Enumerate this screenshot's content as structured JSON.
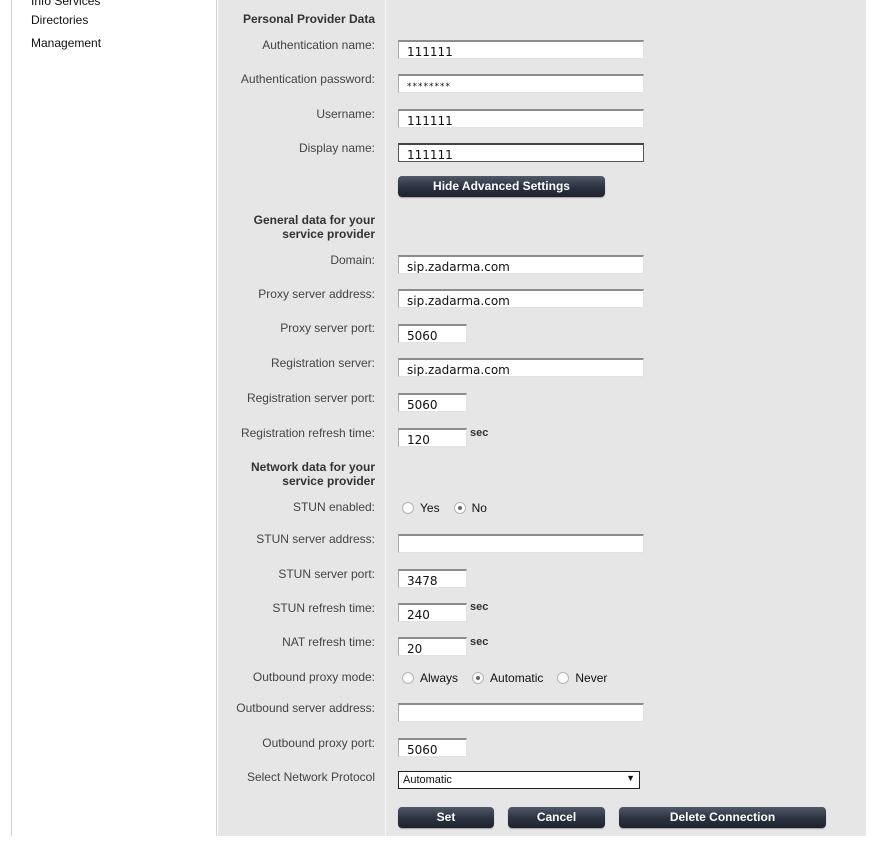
{
  "nav": {
    "items": [
      "Info Services",
      "Directories",
      "Management"
    ]
  },
  "personal": {
    "title": "Personal Provider Data",
    "auth_name_label": "Authentication name:",
    "auth_name_value": "111111",
    "auth_password_label": "Authentication password:",
    "auth_password_value": "********",
    "username_label": "Username:",
    "username_value": "111111",
    "display_name_label": "Display name:",
    "display_name_value": "111111"
  },
  "advanced_button": "Hide Advanced Settings",
  "general": {
    "title_line1": "General data for your",
    "title_line2": "service provider",
    "domain_label": "Domain:",
    "domain_value": "sip.zadarma.com",
    "proxy_address_label": "Proxy server address:",
    "proxy_address_value": "sip.zadarma.com",
    "proxy_port_label": "Proxy server port:",
    "proxy_port_value": "5060",
    "registration_server_label": "Registration server:",
    "registration_server_value": "sip.zadarma.com",
    "registration_port_label": "Registration server port:",
    "registration_port_value": "5060",
    "registration_refresh_label": "Registration refresh time:",
    "registration_refresh_value": "120",
    "unit_sec": "sec"
  },
  "network": {
    "title_line1": "Network data for your",
    "title_line2": "service provider",
    "stun_enabled_label": "STUN enabled:",
    "stun_options": [
      "Yes",
      "No"
    ],
    "stun_selected": "No",
    "stun_address_label": "STUN server address:",
    "stun_address_value": "",
    "stun_port_label": "STUN server port:",
    "stun_port_value": "3478",
    "stun_refresh_label": "STUN refresh time:",
    "stun_refresh_value": "240",
    "nat_refresh_label": "NAT refresh time:",
    "nat_refresh_value": "20",
    "outbound_mode_label": "Outbound proxy mode:",
    "outbound_mode_options": [
      "Always",
      "Automatic",
      "Never"
    ],
    "outbound_mode_selected": "Automatic",
    "outbound_address_label": "Outbound server address:",
    "outbound_address_value": "",
    "outbound_port_label": "Outbound proxy port:",
    "outbound_port_value": "5060",
    "protocol_label": "Select Network Protocol",
    "protocol_value": "Automatic"
  },
  "actions": {
    "set": "Set",
    "cancel": "Cancel",
    "delete": "Delete Connection"
  },
  "colors": {
    "panel_bg": "#e6e6e6",
    "button_bg": "#2d3442",
    "label_text": "#444444"
  }
}
